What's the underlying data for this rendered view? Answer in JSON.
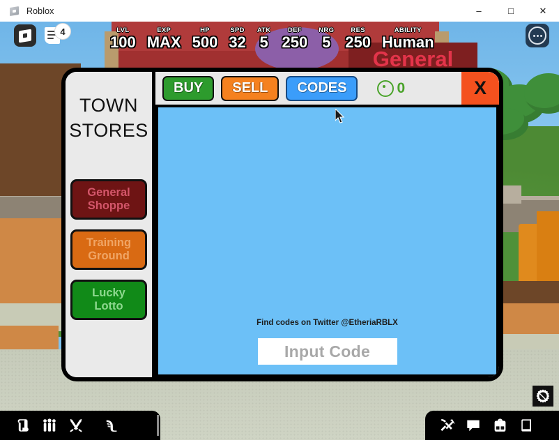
{
  "window": {
    "title": "Roblox",
    "icon": "roblox-logo-icon",
    "minimize": "–",
    "maximize": "□",
    "close": "✕"
  },
  "hud_top": {
    "roblox_button": "roblox-home-icon",
    "chat_button": "chat-icon",
    "chat_badge": "4",
    "more_button": "more-options-icon"
  },
  "stats": [
    {
      "label": "LVL",
      "value": "100"
    },
    {
      "label": "EXP",
      "value": "MAX"
    },
    {
      "label": "HP",
      "value": "500"
    },
    {
      "label": "SPD",
      "value": "32"
    },
    {
      "label": "ATK",
      "value": "5"
    },
    {
      "label": "DEF",
      "value": "250"
    },
    {
      "label": "NRG",
      "value": "5"
    },
    {
      "label": "RES",
      "value": "250"
    },
    {
      "label": "ABILITY",
      "value": "Human"
    }
  ],
  "world": {
    "shop_sign": "General"
  },
  "shop": {
    "sidebar": {
      "title_line1": "TOWN",
      "title_line2": "STORES",
      "stores": [
        {
          "line1": "General",
          "line2": "Shoppe",
          "color": "#6e1414",
          "text_color": "#d4566a"
        },
        {
          "line1": "Training",
          "line2": "Ground",
          "color": "#d96a13",
          "text_color": "#f0a565"
        },
        {
          "line1": "Lucky",
          "line2": "Lotto",
          "color": "#118a18",
          "text_color": "#8ed88f"
        }
      ]
    },
    "tabs": [
      {
        "label": "BUY",
        "color": "#2d9b2d",
        "active": false
      },
      {
        "label": "SELL",
        "color": "#f5811f",
        "active": false
      },
      {
        "label": "CODES",
        "color": "#3b9dfa",
        "active": true
      }
    ],
    "currency": {
      "icon": "coin-icon",
      "amount": "0",
      "color": "#4aa32a"
    },
    "close_label": "X",
    "panel_color": "#6cc0f7",
    "codes_note": "Find codes on Twitter @EtheriaRBLX",
    "code_input_placeholder": "Input Code",
    "code_input_value": ""
  },
  "hud_bottom_left": [
    {
      "icon": "quest-scroll-icon"
    },
    {
      "icon": "party-group-icon"
    },
    {
      "icon": "crossed-swords-icon"
    },
    {
      "icon": "winged-boot-icon"
    }
  ],
  "hud_bottom_right": [
    {
      "icon": "crossed-tools-icon"
    },
    {
      "icon": "chat-bubble-icon"
    },
    {
      "icon": "backpack-icon"
    },
    {
      "icon": "book-icon"
    }
  ],
  "compass": {
    "icon": "compass-disabled-icon"
  }
}
